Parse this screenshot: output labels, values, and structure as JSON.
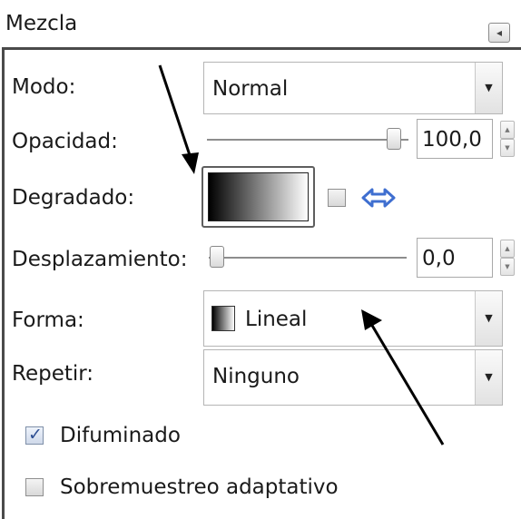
{
  "panel": {
    "title": "Mezcla",
    "collapse_icon": "collapse-icon"
  },
  "rows": {
    "mode": {
      "label": "Modo:",
      "value": "Normal"
    },
    "opacity": {
      "label": "Opacidad:",
      "value": "100,0",
      "slider_fraction": 1.0
    },
    "gradient": {
      "label": "Degradado:",
      "reverse_checked": false,
      "swap_icon": "swap-arrows-icon"
    },
    "offset": {
      "label": "Desplazamiento:",
      "value": "0,0",
      "slider_fraction": 0.0
    },
    "shape": {
      "label": "Forma:",
      "value": "Lineal"
    },
    "repeat": {
      "label": "Repetir:",
      "value": "Ninguno"
    }
  },
  "options": {
    "dither": {
      "label": "Difuminado",
      "checked": true
    },
    "supersample": {
      "label": "Sobremuestreo adaptativo",
      "checked": false
    }
  },
  "colors": {
    "accent": "#2e4f93",
    "swap_icon": "#3f6fd0"
  }
}
